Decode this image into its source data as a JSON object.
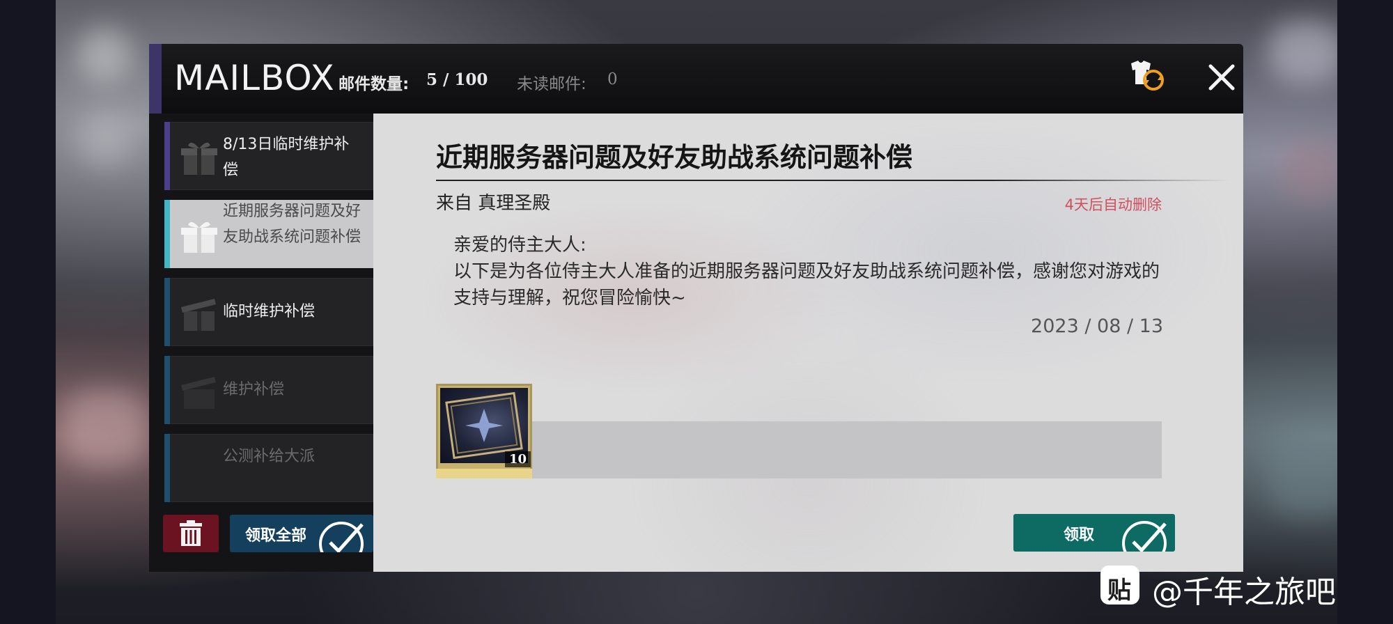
{
  "header": {
    "title": "MAILBOX",
    "count_label": "邮件数量:",
    "count_value": "5 / 100",
    "unread_label": "未读邮件:",
    "unread_value": "0"
  },
  "mail_list": [
    {
      "label": "8/13日临时维护补偿",
      "state": "dark",
      "stripe": "#4a3f8a"
    },
    {
      "label": "近期服务器问题及好友助战系统问题补偿",
      "state": "selected",
      "stripe": "#43b6c6"
    },
    {
      "label": "临时维护补偿",
      "state": "dark",
      "stripe": "#1f4f6c"
    },
    {
      "label": "维护补偿",
      "state": "dim",
      "stripe": "#1f4f6c"
    },
    {
      "label": "公测补给大派",
      "state": "dim",
      "stripe": "#1f4f6c"
    }
  ],
  "sidebar_actions": {
    "claim_all_label": "领取全部"
  },
  "mail": {
    "subject": "近期服务器问题及好友助战系统问题补偿",
    "sender": "来自 真理圣殿",
    "expiry": "4天后自动删除",
    "greeting": "亲爱的侍主大人:",
    "body": "以下是为各位侍主大人准备的近期服务器问题及好友助战系统问题补偿，感谢您对游戏的支持与理解，祝您冒险愉快~",
    "date": "2023 / 08 / 13",
    "rewards": [
      {
        "icon": "ticket-card-icon",
        "quantity": "10"
      }
    ],
    "claim_label": "领取"
  },
  "watermark": {
    "logo_text": "贴",
    "text": "@千年之旅吧"
  },
  "colors": {
    "title_bar": "#0e0e10",
    "content_bg": "#dcdcdd",
    "expiry_red": "#d05060",
    "claim_green": "#0d6b63",
    "claim_all_blue": "#14405e",
    "delete_red": "#6b1320"
  }
}
